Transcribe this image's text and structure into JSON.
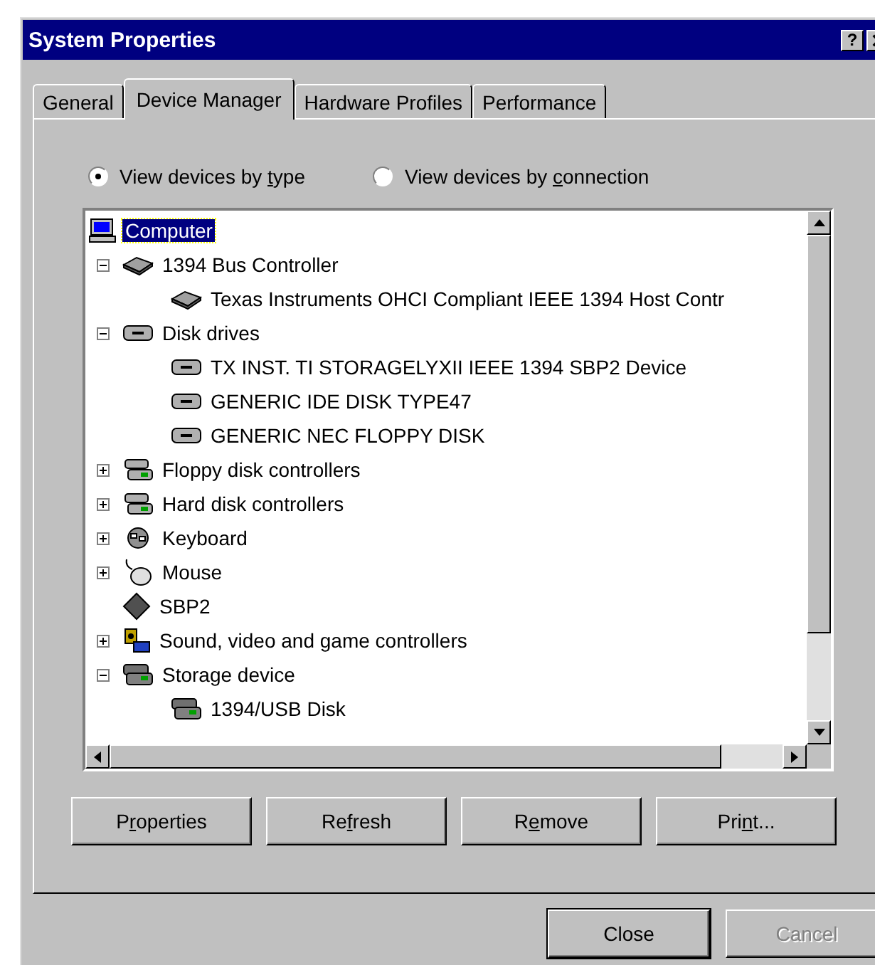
{
  "window": {
    "title": "System Properties",
    "help": "?"
  },
  "tabs": [
    {
      "label": "General",
      "selected": false
    },
    {
      "label": "Device Manager",
      "selected": true
    },
    {
      "label": "Hardware Profiles",
      "selected": false
    },
    {
      "label": "Performance",
      "selected": false
    }
  ],
  "view_options": [
    {
      "before": "View devices by ",
      "key": "t",
      "after": "ype",
      "selected": true
    },
    {
      "before": "View devices by ",
      "key": "c",
      "after": "onnection",
      "selected": false
    }
  ],
  "tree": [
    {
      "label": "Computer",
      "kind": "computer",
      "selected": true,
      "children": [
        {
          "label": "1394 Bus Controller",
          "kind": "bus",
          "selected": false,
          "expanded": true,
          "children": [
            {
              "label": "Texas Instruments OHCI Compliant IEEE 1394 Host Contr",
              "kind": "bus",
              "selected": false
            }
          ]
        },
        {
          "label": "Disk drives",
          "kind": "disk",
          "selected": false,
          "expanded": true,
          "children": [
            {
              "label": "TX INST. TI STORAGELYXII IEEE 1394 SBP2 Device",
              "kind": "disk",
              "selected": false
            },
            {
              "label": "GENERIC IDE  DISK TYPE47",
              "kind": "disk",
              "selected": false
            },
            {
              "label": "GENERIC NEC  FLOPPY DISK",
              "kind": "disk",
              "selected": false
            }
          ]
        },
        {
          "label": "Floppy disk controllers",
          "kind": "controller",
          "selected": false,
          "expanded": false
        },
        {
          "label": "Hard disk controllers",
          "kind": "controller",
          "selected": false,
          "expanded": false
        },
        {
          "label": "Keyboard",
          "kind": "keyboard",
          "selected": false,
          "expanded": false
        },
        {
          "label": "Mouse",
          "kind": "mouse",
          "selected": false,
          "expanded": false
        },
        {
          "label": "SBP2",
          "kind": "diamond",
          "selected": false
        },
        {
          "label": "Sound, video and game controllers",
          "kind": "sound",
          "selected": false,
          "expanded": false
        },
        {
          "label": "Storage device",
          "kind": "storage",
          "selected": false,
          "expanded": true,
          "children": [
            {
              "label": "1394/USB Disk",
              "kind": "storage",
              "selected": false
            }
          ]
        }
      ]
    }
  ],
  "panel_buttons": [
    {
      "before": "P",
      "key": "r",
      "after": "operties",
      "disabled": false
    },
    {
      "before": "Re",
      "key": "f",
      "after": "resh",
      "disabled": false
    },
    {
      "before": "R",
      "key": "e",
      "after": "move",
      "disabled": false
    },
    {
      "before": "Pri",
      "key": "n",
      "after": "t...",
      "disabled": false
    }
  ],
  "dialog_buttons": [
    {
      "label": "Close",
      "disabled": false
    },
    {
      "label": "Cancel",
      "disabled": true
    }
  ]
}
